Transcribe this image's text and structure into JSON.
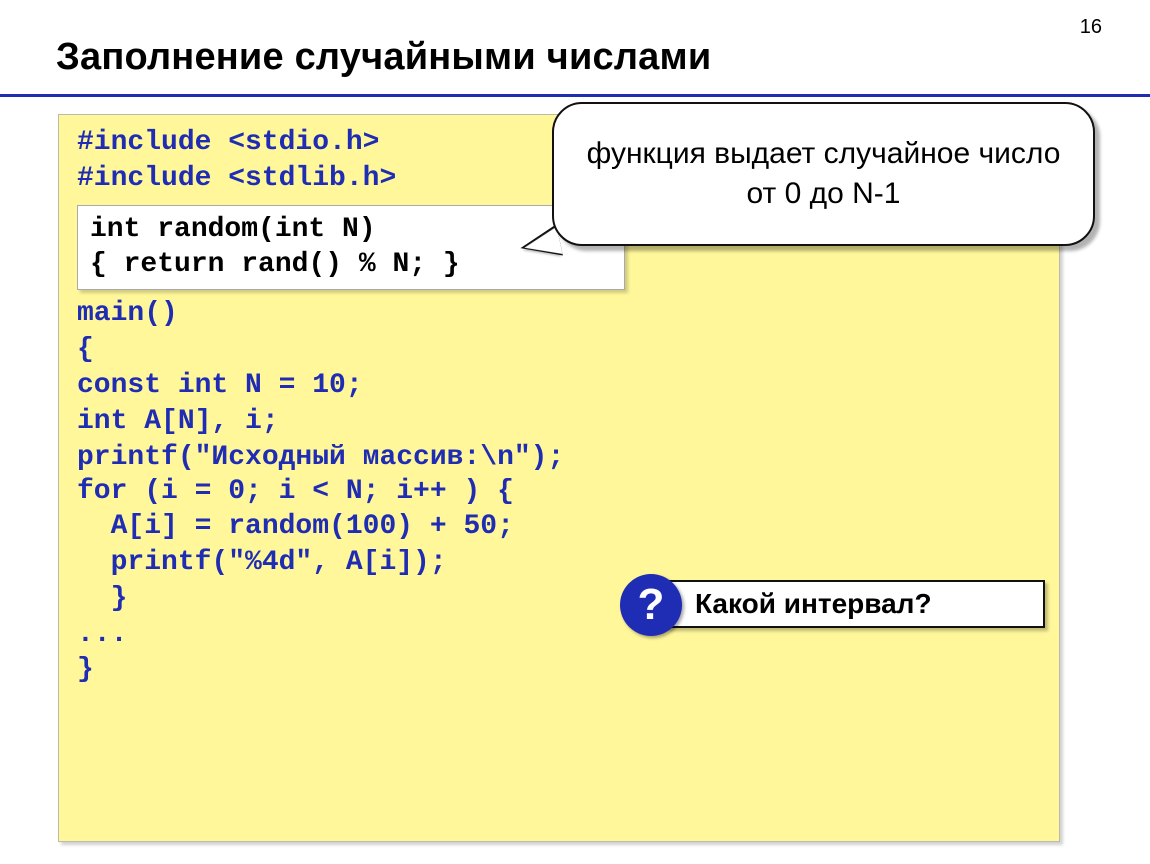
{
  "page_number": "16",
  "title": "Заполнение случайными числами",
  "code": {
    "l1": "#include <stdio.h>",
    "l2": "#include <stdlib.h>",
    "snippet_l1": "int random(int N)",
    "snippet_l2": "{ return rand() % N; }",
    "l3": "main()",
    "l4": "{",
    "l5": "const int N = 10;",
    "l6": "int A[N], i;",
    "l7": "printf(\"Исходный массив:\\n\");",
    "l8": "for (i = 0; i < N; i++ ) {",
    "l9": "  A[i] = random(100) + 50;",
    "l10": "  printf(\"%4d\", A[i]);",
    "l11": "  }",
    "l12": "...",
    "l13": "}"
  },
  "callout1": "функция выдает случайное число от 0 до N-1",
  "question_mark": "?",
  "callout2": "Какой интервал?"
}
